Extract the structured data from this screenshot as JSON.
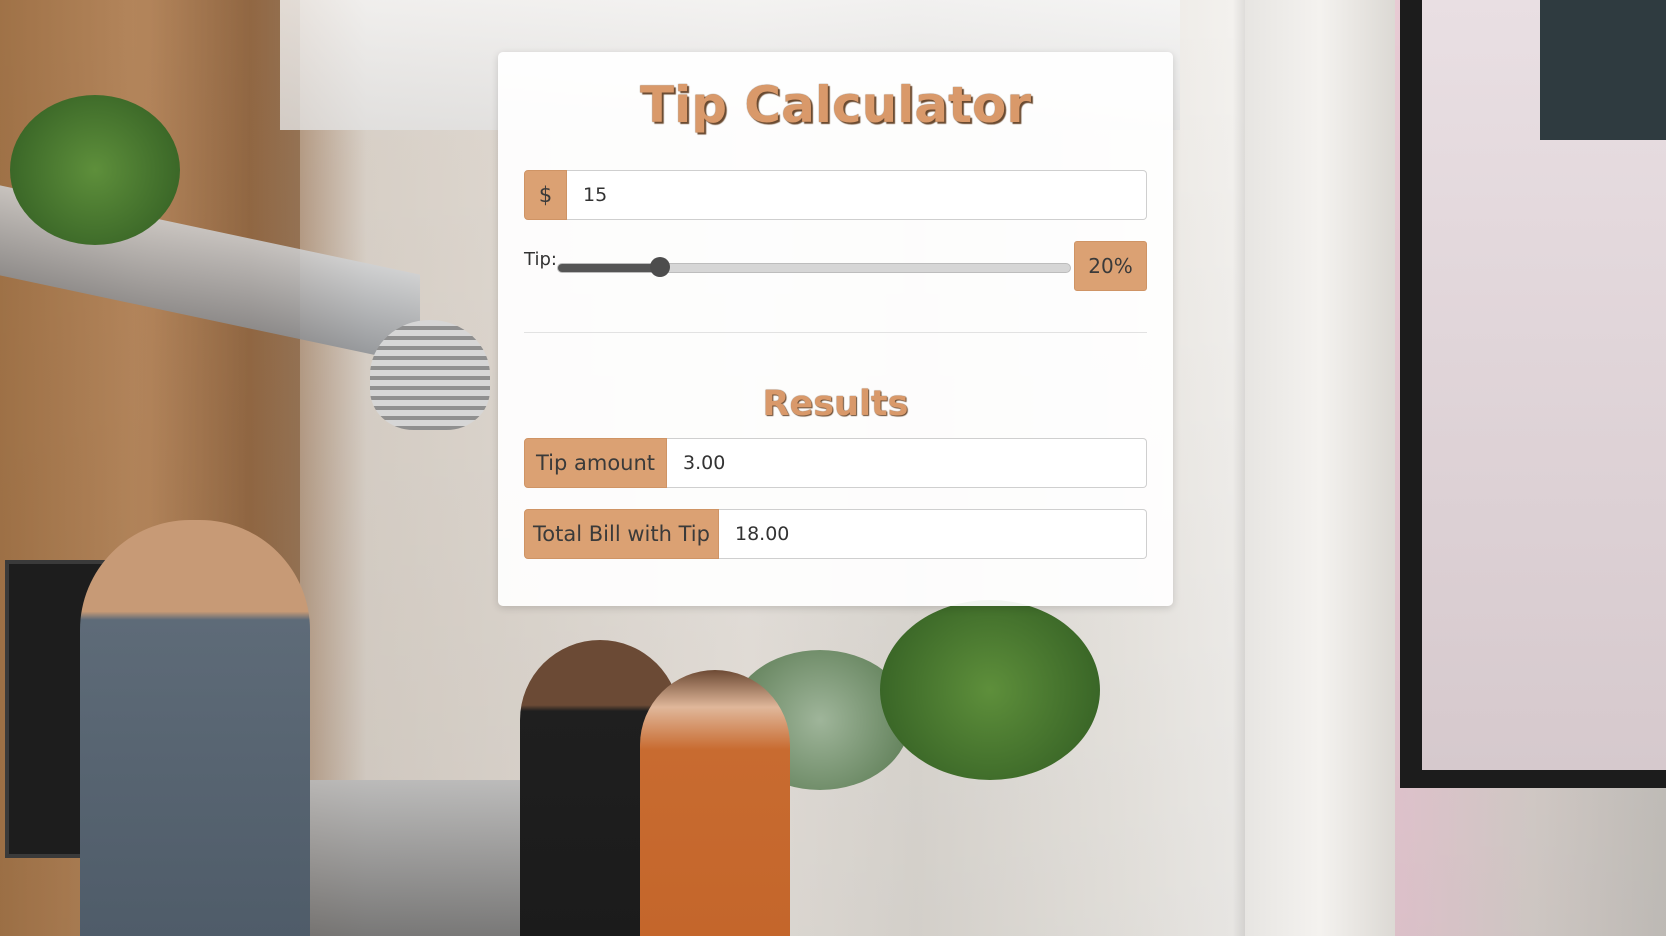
{
  "app": {
    "title": "Tip Calculator"
  },
  "bill": {
    "currency_symbol": "$",
    "value": "15"
  },
  "tip": {
    "label": "Tip:",
    "percent": 20,
    "percent_label": "20%",
    "slider_fraction": 0.2
  },
  "results": {
    "title": "Results",
    "tip_amount_label": "Tip amount",
    "tip_amount_value": "3.00",
    "total_label": "Total Bill with Tip",
    "total_value": "18.00"
  },
  "colors": {
    "accent": "#dba173",
    "title_text": "#d9996a",
    "title_shadow": "#6a4a30",
    "slider_fill": "#555555"
  }
}
